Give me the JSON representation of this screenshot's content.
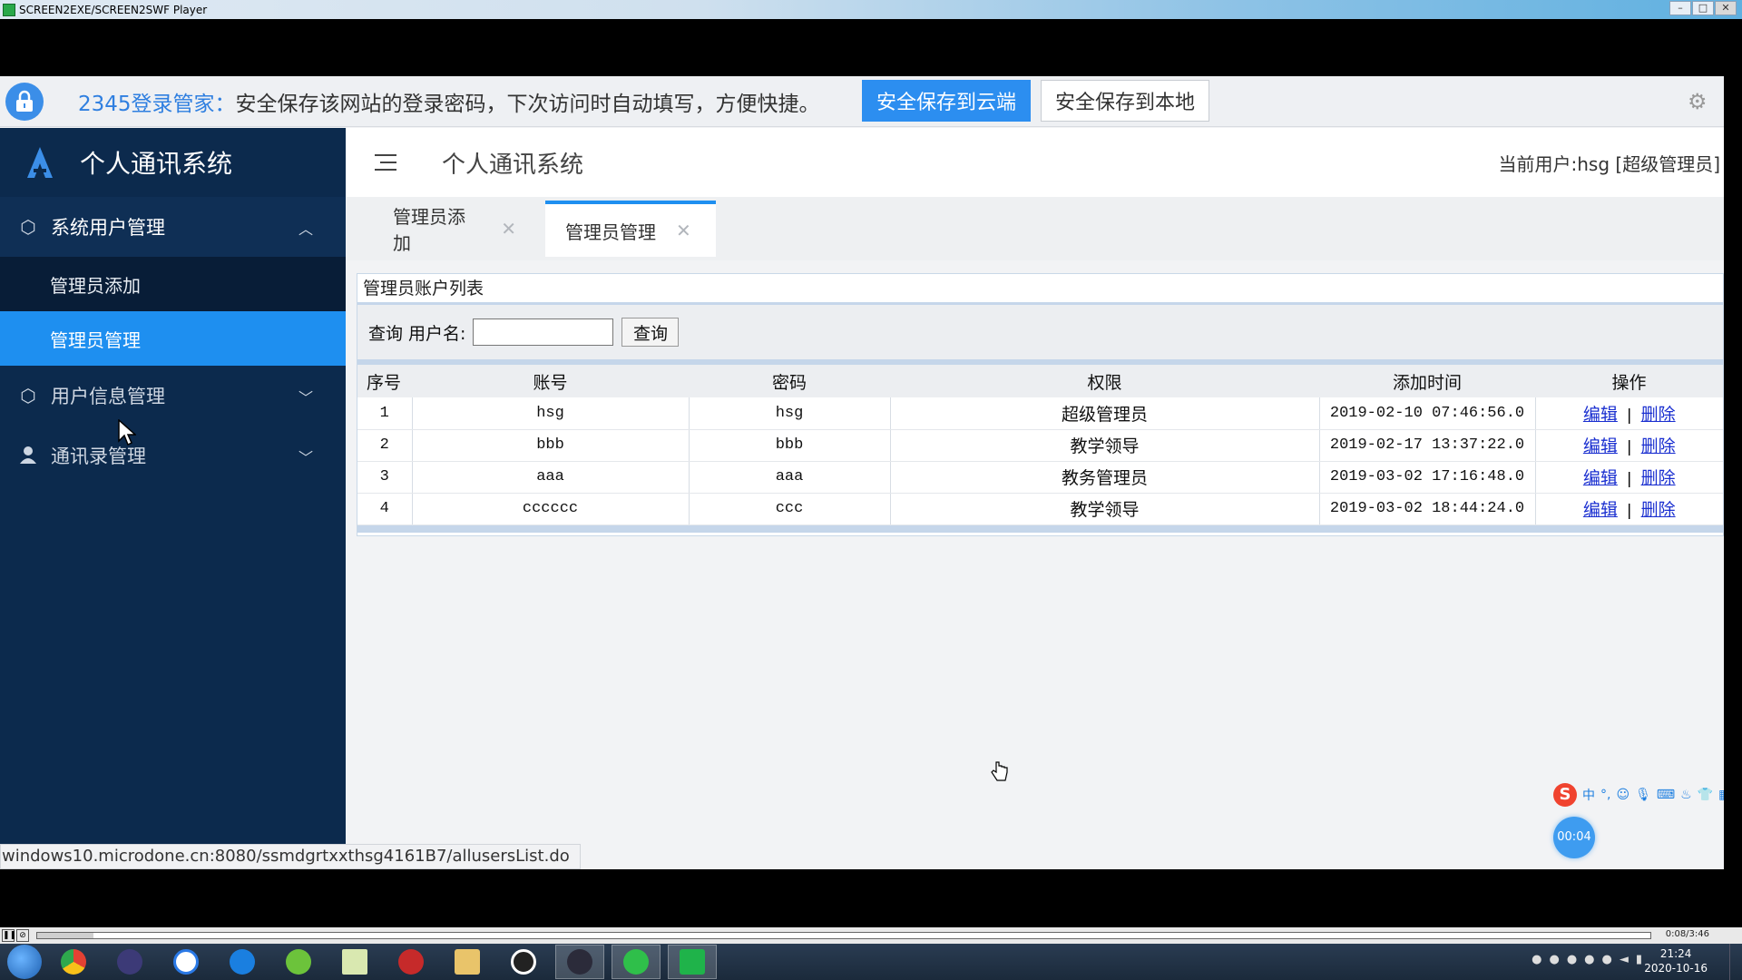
{
  "player": {
    "title": "SCREEN2EXE/SCREEN2SWF Player",
    "window_controls": [
      "–",
      "□",
      "✕"
    ],
    "elapsed": "0:08/3:46",
    "progress": 0.035
  },
  "password_banner": {
    "brand": "2345登录管家：",
    "message": "安全保存该网站的登录密码，下次访问时自动填写，方便快捷。",
    "save_cloud_label": "安全保存到云端",
    "save_local_label": "安全保存到本地"
  },
  "sidebar": {
    "app_title": "个人通讯系统",
    "groups": [
      {
        "label": "系统用户管理",
        "icon": "cube-icon",
        "expanded": true,
        "items": [
          {
            "label": "管理员添加",
            "active": false
          },
          {
            "label": "管理员管理",
            "active": true
          }
        ]
      },
      {
        "label": "用户信息管理",
        "icon": "cube-icon",
        "expanded": false
      },
      {
        "label": "通讯录管理",
        "icon": "user-icon",
        "expanded": false
      }
    ]
  },
  "header": {
    "title": "个人通讯系统",
    "current_user": "当前用户:hsg [超级管理员]"
  },
  "tabs": [
    {
      "label": "管理员添加",
      "active": false
    },
    {
      "label": "管理员管理",
      "active": true
    }
  ],
  "panel": {
    "title": "管理员账户列表",
    "search_label": "查询 用户名:",
    "search_value": "",
    "search_button": "查询",
    "columns": [
      "序号",
      "账号",
      "密码",
      "权限",
      "添加时间",
      "操作"
    ],
    "rows": [
      {
        "no": "1",
        "account": "hsg",
        "password": "hsg",
        "role": "超级管理员",
        "added": "2019-02-10 07:46:56.0"
      },
      {
        "no": "2",
        "account": "bbb",
        "password": "bbb",
        "role": "教学领导",
        "added": "2019-02-17 13:37:22.0"
      },
      {
        "no": "3",
        "account": "aaa",
        "password": "aaa",
        "role": "教务管理员",
        "added": "2019-03-02 17:16:48.0"
      },
      {
        "no": "4",
        "account": "cccccc",
        "password": "ccc",
        "role": "教学领导",
        "added": "2019-03-02 18:44:24.0"
      }
    ],
    "edit_label": "编辑",
    "delete_label": "删除",
    "action_separator": "|"
  },
  "status_url": "windows10.microdone.cn:8080/ssmdgrtxxthsg4161B7/allusersList.do",
  "ime": {
    "mode": "中",
    "punct": "°,",
    "icons": [
      "emoji-icon",
      "mic-icon",
      "keyboard-icon",
      "skin-icon",
      "shirt-icon",
      "grid-icon"
    ]
  },
  "timer": "00:04",
  "taskbar": {
    "apps": [
      "chrome-icon",
      "eclipse-icon",
      "baidu-netdisk-icon",
      "browser-icon",
      "green-app-icon",
      "notepad-icon",
      "flash-icon",
      "folder-icon",
      "qq-icon",
      "eclipse-dark-icon",
      "wechat-icon",
      "screen-recorder-icon"
    ],
    "time": "21:24",
    "date": "2020-10-16"
  },
  "colors": {
    "sidebar_bg": "#0c2a4d",
    "active_blue": "#1e8ff0",
    "link_blue": "#1a2fd0"
  }
}
